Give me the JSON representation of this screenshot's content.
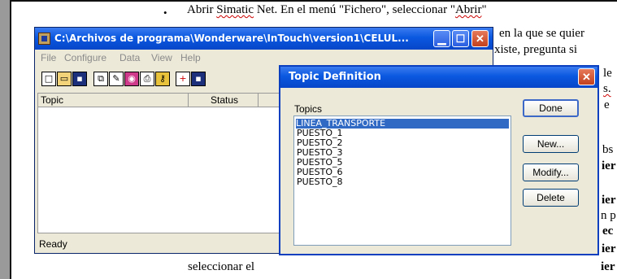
{
  "document": {
    "bullet": "•",
    "line1_pre": "Abrir ",
    "line1_wavy1": "Simatic",
    "line1_mid": " Net. En el menú \"Fichero\", seleccionar \"",
    "line1_wavy2": "Abrir",
    "line1_post": "\"",
    "frag_right": [
      "en la que se quier",
      "xiste, pregunta si",
      "le",
      "s.",
      "e",
      "bs",
      "ier",
      "ier",
      "n p",
      "ec",
      "ier"
    ],
    "bottom_pre": "seleccionar el",
    "bottom_post": "ier"
  },
  "app": {
    "title": "C:\\Archivos de programa\\Wonderware\\InTouch\\version1\\CELUL...",
    "menu": [
      "File",
      "Configure",
      "Data",
      "View",
      "Help"
    ],
    "columns": [
      "Topic",
      "Status"
    ],
    "status": "Ready",
    "toolbar_icons": [
      "new-icon",
      "open-icon",
      "save-icon",
      "copy-icon",
      "edit-icon",
      "monitor-icon",
      "print-icon",
      "key-icon",
      "add-topic-icon",
      "save-topic-icon"
    ]
  },
  "dialog": {
    "title": "Topic Definition",
    "topics_label": "Topics",
    "topics": [
      "LINEA_TRANSPORTE",
      "PUESTO_1",
      "PUESTO_2",
      "PUESTO_3",
      "PUESTO_5",
      "PUESTO_6",
      "PUESTO_8"
    ],
    "selected_topic": "LINEA_TRANSPORTE",
    "buttons": {
      "done": "Done",
      "new": "New...",
      "modify": "Modify...",
      "delete": "Delete"
    }
  },
  "colors": {
    "titlebar": "#0a58e0",
    "selection": "#316ac5",
    "close_button": "#c3401e"
  }
}
